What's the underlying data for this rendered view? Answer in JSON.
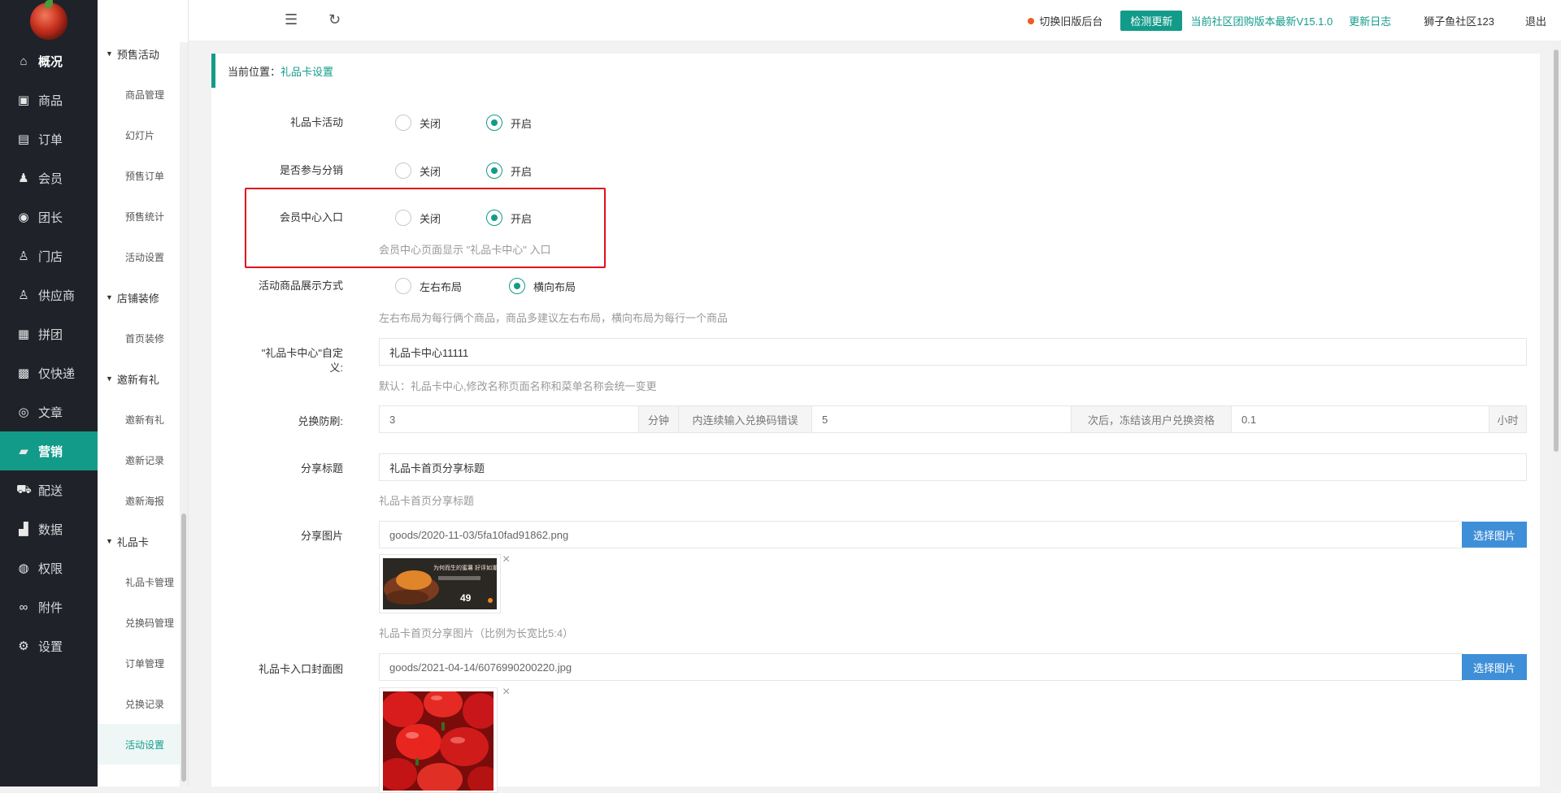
{
  "nav": {
    "items": [
      {
        "icon": "home-icon",
        "glyph": "⌂",
        "label": "概况"
      },
      {
        "icon": "goods-icon",
        "glyph": "▣",
        "label": "商品"
      },
      {
        "icon": "order-icon",
        "glyph": "▤",
        "label": "订单"
      },
      {
        "icon": "member-icon",
        "glyph": "♟",
        "label": "会员"
      },
      {
        "icon": "leader-icon",
        "glyph": "◉",
        "label": "团长"
      },
      {
        "icon": "store-icon",
        "glyph": "♙",
        "label": "门店"
      },
      {
        "icon": "supplier-icon",
        "glyph": "♙",
        "label": "供应商"
      },
      {
        "icon": "group-buy-icon",
        "glyph": "▦",
        "label": "拼团"
      },
      {
        "icon": "express-icon",
        "glyph": "▩",
        "label": "仅快递"
      },
      {
        "icon": "article-icon",
        "glyph": "◎",
        "label": "文章"
      },
      {
        "icon": "marketing-icon",
        "glyph": "▰",
        "label": "营销"
      },
      {
        "icon": "delivery-icon",
        "glyph": "⛟",
        "label": "配送"
      },
      {
        "icon": "data-icon",
        "glyph": "▟",
        "label": "数据"
      },
      {
        "icon": "permission-icon",
        "glyph": "◍",
        "label": "权限"
      },
      {
        "icon": "attachment-icon",
        "glyph": "∞",
        "label": "附件"
      },
      {
        "icon": "settings-icon",
        "glyph": "⚙",
        "label": "设置"
      }
    ]
  },
  "subnav": {
    "presale": {
      "title": "预售活动",
      "items": [
        "商品管理",
        "幻灯片",
        "预售订单",
        "预售统计",
        "活动设置"
      ]
    },
    "decor": {
      "title": "店铺装修",
      "items": [
        "首页装修"
      ]
    },
    "invite": {
      "title": "邀新有礼",
      "items": [
        "邀新有礼",
        "邀新记录",
        "邀新海报"
      ]
    },
    "giftcard": {
      "title": "礼品卡",
      "items": [
        "礼品卡管理",
        "兑换码管理",
        "订单管理",
        "兑换记录",
        "活动设置"
      ]
    }
  },
  "topbar": {
    "switch_label": "切换旧版后台",
    "check_label": "检测更新",
    "version_text": "当前社区团购版本最新V15.1.0",
    "changelog_label": "更新日志",
    "user_name": "狮子鱼社区123",
    "logout_label": "退出"
  },
  "breadcrumb": {
    "prefix": "当前位置：",
    "current": "礼品卡设置"
  },
  "form": {
    "giftcard_activity": {
      "label": "礼品卡活动",
      "off": "关闭",
      "on": "开启",
      "selected": "on"
    },
    "distribution": {
      "label": "是否参与分销",
      "off": "关闭",
      "on": "开启",
      "selected": "on"
    },
    "member_entry": {
      "label": "会员中心入口",
      "off": "关闭",
      "on": "开启",
      "selected": "on",
      "tip": "会员中心页面显示 \"礼品卡中心\" 入口"
    },
    "display_mode": {
      "label": "活动商品展示方式",
      "left_right": "左右布局",
      "horizontal": "横向布局",
      "selected": "horizontal",
      "tip": "左右布局为每行俩个商品，商品多建议左右布局，横向布局为每行一个商品"
    },
    "custom_name": {
      "label_line1": "\"礼品卡中心\"自定",
      "label_line2": "义:",
      "value": "礼品卡中心11111",
      "tip": "默认：礼品卡中心,修改名称页面名称和菜单名称会统一变更"
    },
    "anti_brush": {
      "label": "兑换防刷:",
      "minutes": "3",
      "minutes_unit": "分钟",
      "mid_text": "内连续输入兑换码错误",
      "times": "5",
      "after_text": "次后，冻结该用户兑换资格",
      "hours": "0.1",
      "hours_unit": "小时"
    },
    "share_title": {
      "label": "分享标题",
      "value": "礼品卡首页分享标题",
      "tip": "礼品卡首页分享标题"
    },
    "share_image": {
      "label": "分享图片",
      "value": "goods/2020-11-03/5fa10fad91862.png",
      "button": "选择图片",
      "tip": "礼品卡首页分享图片（比例为长宽比5:4）",
      "thumb_caption": "为何而生的蜜薯 好评如潮",
      "thumb_price": "49"
    },
    "cover_image": {
      "label": "礼品卡入口封面图",
      "value": "goods/2021-04-14/6076990200220.jpg",
      "button": "选择图片"
    },
    "close_glyph": "×"
  },
  "colors": {
    "accent": "#139b8a",
    "highlight": "#e0101a",
    "button_blue": "#3f8fd8"
  }
}
